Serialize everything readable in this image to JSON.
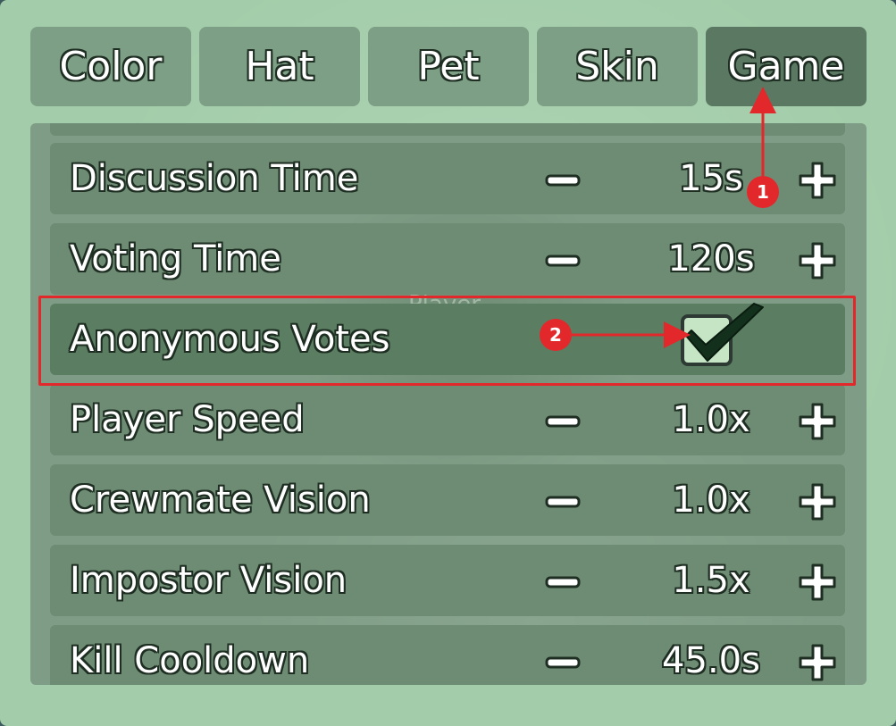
{
  "tabs": [
    {
      "label": "Color",
      "active": false
    },
    {
      "label": "Hat",
      "active": false
    },
    {
      "label": "Pet",
      "active": false
    },
    {
      "label": "Skin",
      "active": false
    },
    {
      "label": "Game",
      "active": true
    }
  ],
  "settings": [
    {
      "label": "Discussion Time",
      "type": "stepper",
      "value": "15s"
    },
    {
      "label": "Voting Time",
      "type": "stepper",
      "value": "120s"
    },
    {
      "label": "Anonymous Votes",
      "type": "checkbox",
      "checked": true
    },
    {
      "label": "Player Speed",
      "type": "stepper",
      "value": "1.0x"
    },
    {
      "label": "Crewmate Vision",
      "type": "stepper",
      "value": "1.0x"
    },
    {
      "label": "Impostor Vision",
      "type": "stepper",
      "value": "1.5x"
    },
    {
      "label": "Kill Cooldown",
      "type": "stepper",
      "value": "45.0s"
    }
  ],
  "background_text": "Player",
  "annotations": [
    {
      "number": "1",
      "points_to": "tab-game"
    },
    {
      "number": "2",
      "points_to": "anonymous-votes-checkbox"
    }
  ],
  "colors": {
    "annotation": "#e3282c",
    "checkbox_fill": "#c5e5c4",
    "checkmark": "#12301c",
    "panel": "#a3cdaa"
  }
}
